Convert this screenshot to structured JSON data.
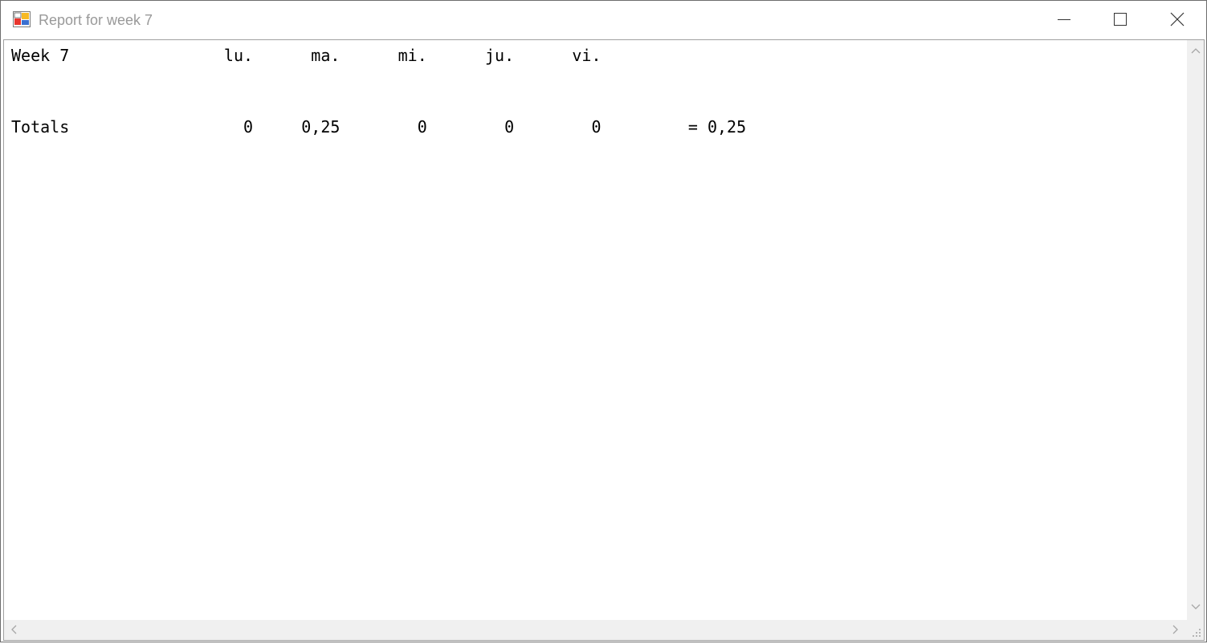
{
  "window": {
    "title": "Report for week 7",
    "icons": {
      "app": "app-icon",
      "minimize": "minimize-icon",
      "maximize": "maximize-icon",
      "close": "close-icon"
    }
  },
  "report": {
    "header_line": "Week 7                lu.      ma.      mi.      ju.      vi.",
    "totals_line": "Totals                  0     0,25        0        0        0         = 0,25",
    "header": {
      "label": "Week 7",
      "days": [
        "lu.",
        "ma.",
        "mi.",
        "ju.",
        "vi."
      ]
    },
    "totals": {
      "label": "Totals",
      "values": [
        "0",
        "0,25",
        "0",
        "0",
        "0"
      ],
      "sum": "= 0,25"
    }
  },
  "scrollbars": {
    "vertical": {
      "up": "arrow-up-icon",
      "down": "arrow-down-icon"
    },
    "horizontal": {
      "left": "arrow-left-icon",
      "right": "arrow-right-icon"
    }
  },
  "colors": {
    "title_text": "#999999",
    "border": "#a0a0a0",
    "scrollbar": "#f0f0f0"
  }
}
